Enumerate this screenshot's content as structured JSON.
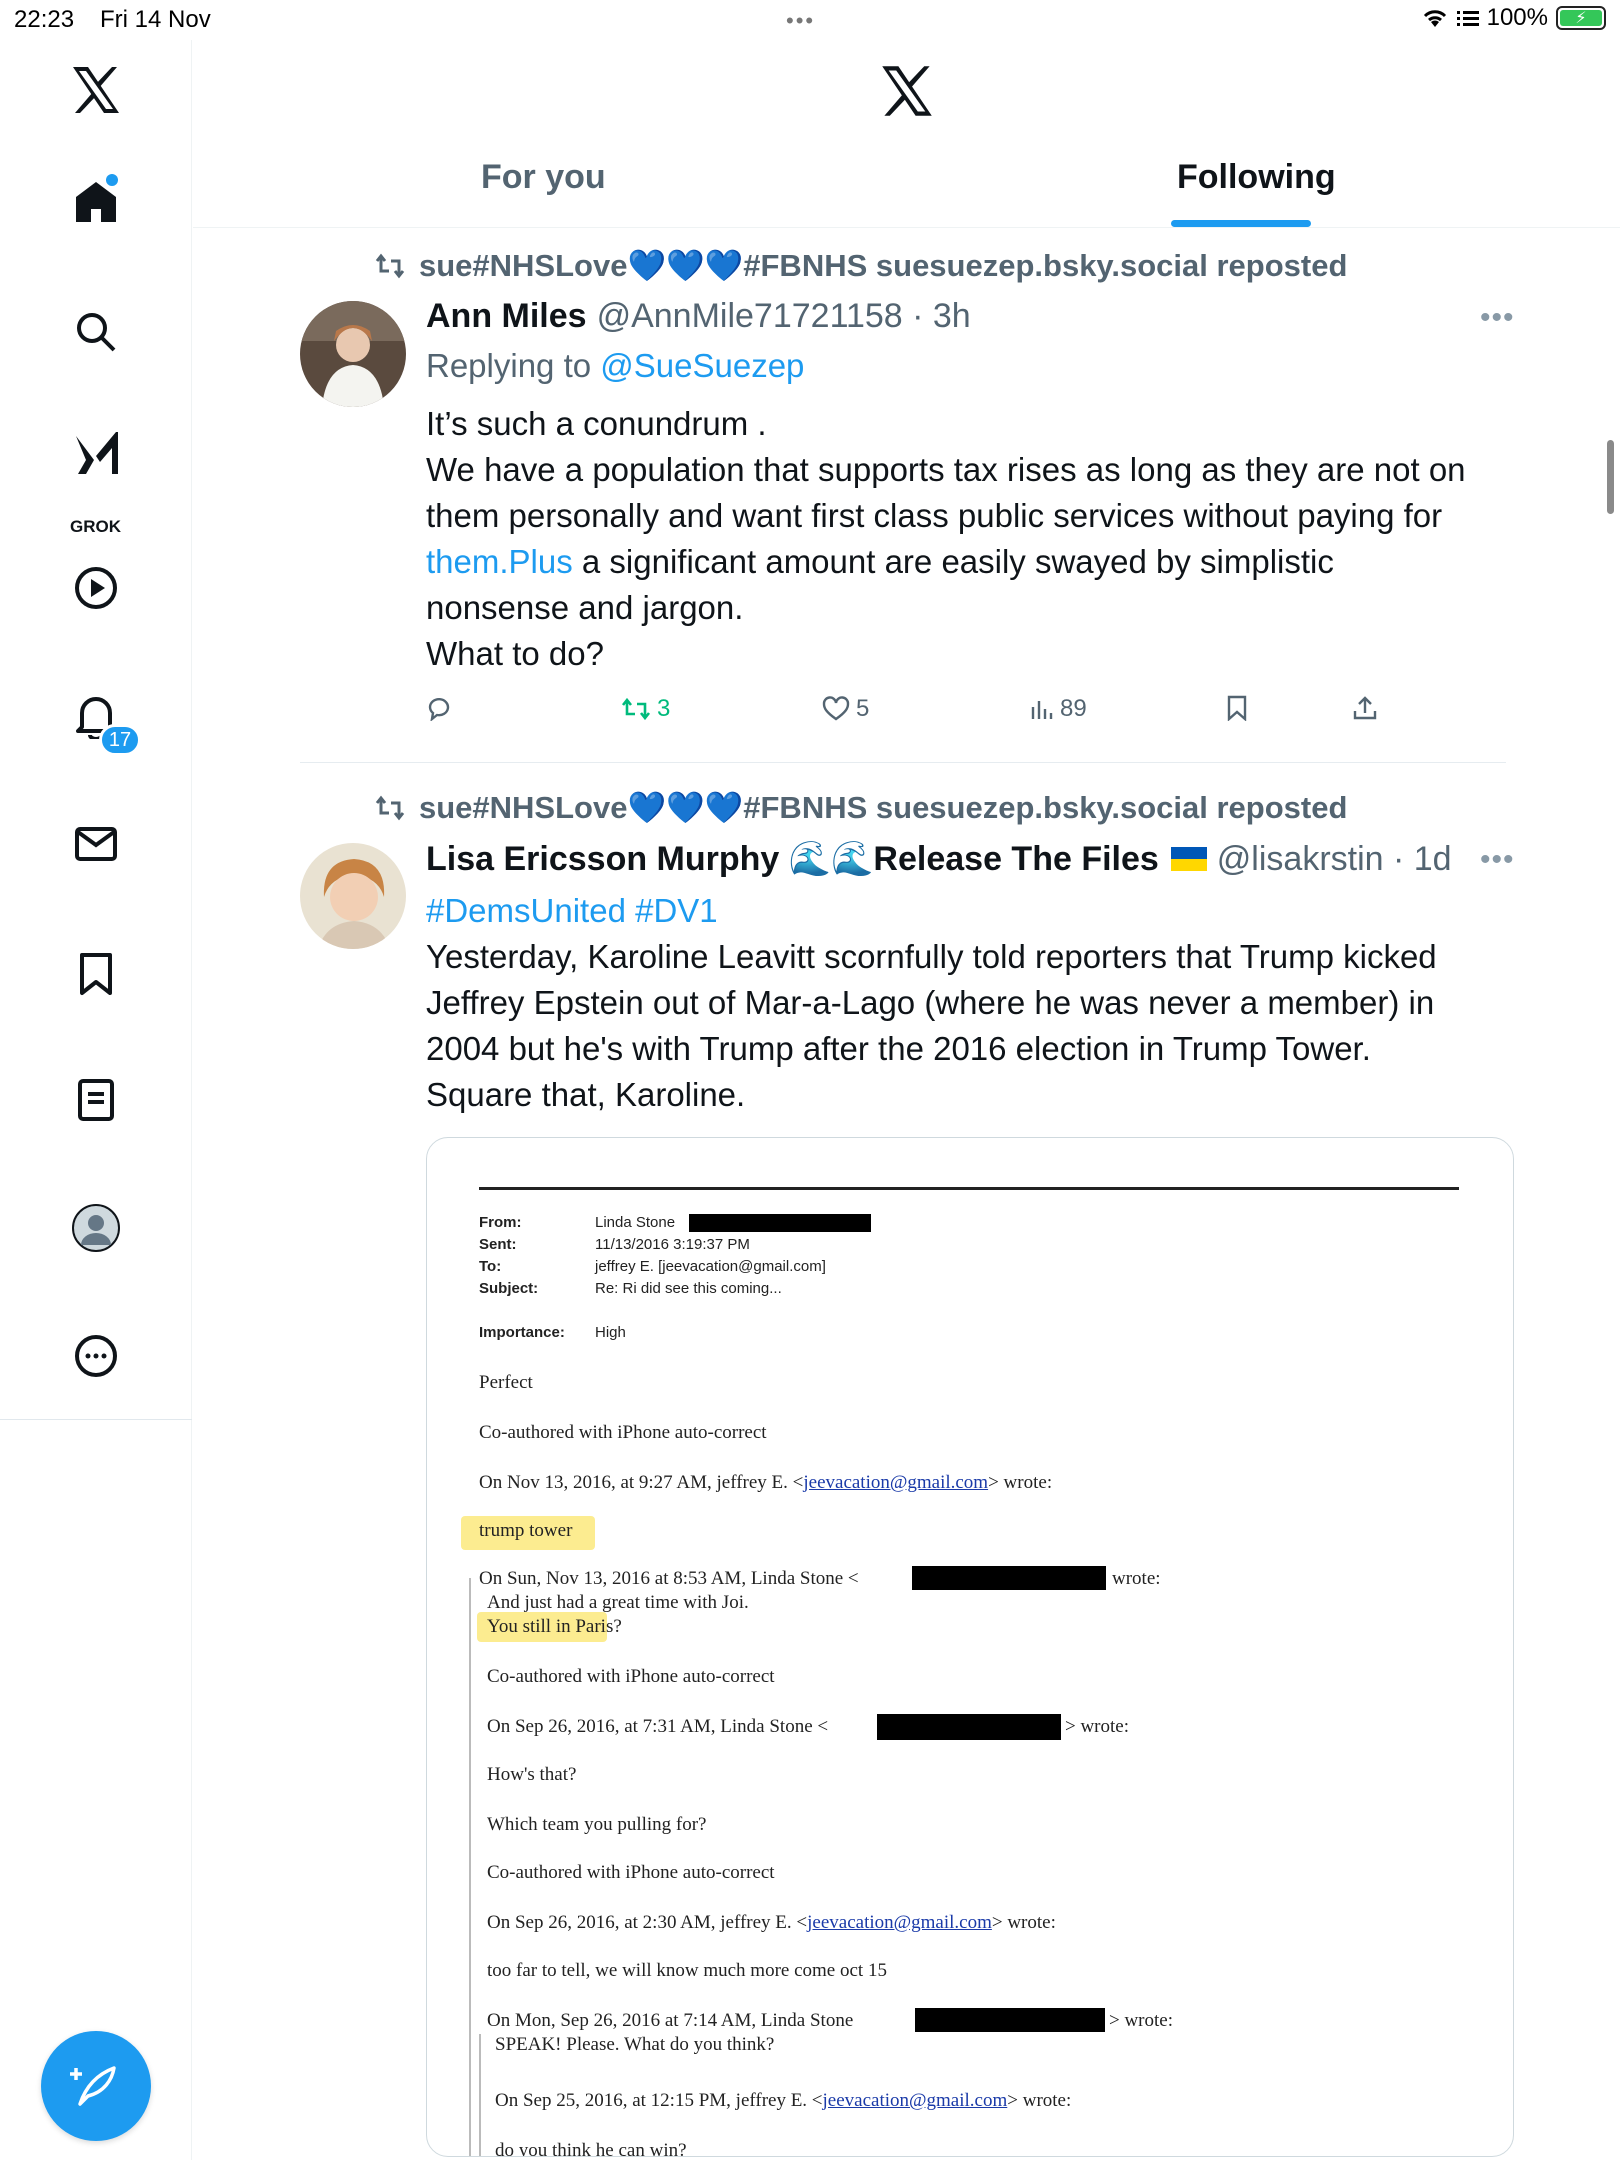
{
  "status": {
    "time": "22:23",
    "date": "Fri 14 Nov",
    "battery": "100%"
  },
  "sidebar": {
    "grok_label": "GROK",
    "notif_count": "17"
  },
  "tabs": {
    "for_you": "For you",
    "following": "Following"
  },
  "tweets": [
    {
      "repost_by": "sue#NHSLove💙💙💙#FBNHS suesuezep.bsky.social reposted",
      "name": "Ann Miles",
      "handle": "@AnnMile71721158 · 3h",
      "reply_prefix": "Replying to ",
      "reply_to": "@SueSuezep",
      "lines": [
        "It’s such a conundrum .",
        "We have a population that supports tax rises as long as they are not on",
        "them personally and want first class public services without paying for"
      ],
      "line4_link": "them.Plus",
      "line4_rest": " a significant amount are easily swayed by simplistic",
      "line5": "nonsense and jargon.",
      "line6": "What to do?",
      "retweets": "3",
      "likes": "5",
      "views": "89"
    },
    {
      "repost_by": "sue#NHSLove💙💙💙#FBNHS suesuezep.bsky.social reposted",
      "name": "Lisa Ericsson Murphy 🌊🌊Release The Files",
      "handle": "@lisakrstin · 1d",
      "hashtags": "#DemsUnited #DV1",
      "lines": [
        "Yesterday, Karoline Leavitt scornfully told reporters that Trump kicked",
        "Jeffrey Epstein out of Mar-a-Lago (where he was never a member) in",
        "2004 but he's with Trump after the 2016 election in Trump Tower.",
        "Square that, Karoline."
      ]
    }
  ],
  "email": {
    "from_k": "From:",
    "from_v": "Linda Stone",
    "sent_k": "Sent:",
    "sent_v": "11/13/2016 3:19:37 PM",
    "to_k": "To:",
    "to_v": "jeffrey E. [jeevacation@gmail.com]",
    "subject_k": "Subject:",
    "subject_v": "Re: Ri did see this coming...",
    "importance_k": "Importance:",
    "importance_v": "High",
    "l1": "Perfect",
    "l2": "Co-authored with iPhone auto-correct",
    "l3a": "On Nov 13, 2016, at 9:27 AM, jeffrey E. <",
    "l3b": "jeevacation@gmail.com",
    "l3c": "> wrote:",
    "l4": "trump tower",
    "l5a": "On Sun, Nov 13, 2016 at 8:53 AM, Linda Stone <",
    "l5c": "wrote:",
    "l6": "And just had a great time with Joi.",
    "l7": "You still in Paris?",
    "l8": "Co-authored with iPhone auto-correct",
    "l9a": "On Sep 26, 2016, at 7:31 AM, Linda Stone <",
    "l9c": "> wrote:",
    "l10": "How's that?",
    "l11": "Which team you pulling for?",
    "l12": "Co-authored with iPhone auto-correct",
    "l13a": "On Sep 26, 2016, at 2:30 AM, jeffrey E. <",
    "l13b": "jeevacation@gmail.com",
    "l13c": "> wrote:",
    "l14": "too far to tell,  we will know much more come oct 15",
    "l15a": "On Mon, Sep 26, 2016 at 7:14 AM, Linda Stone",
    "l15c": "> wrote:",
    "l16": "SPEAK!  Please.  What do you think?",
    "l17a": "On Sep 25, 2016, at 12:15 PM, jeffrey E. <",
    "l17b": "jeevacation@gmail.com",
    "l17c": "> wrote:",
    "l18": "do you think he can win?"
  }
}
